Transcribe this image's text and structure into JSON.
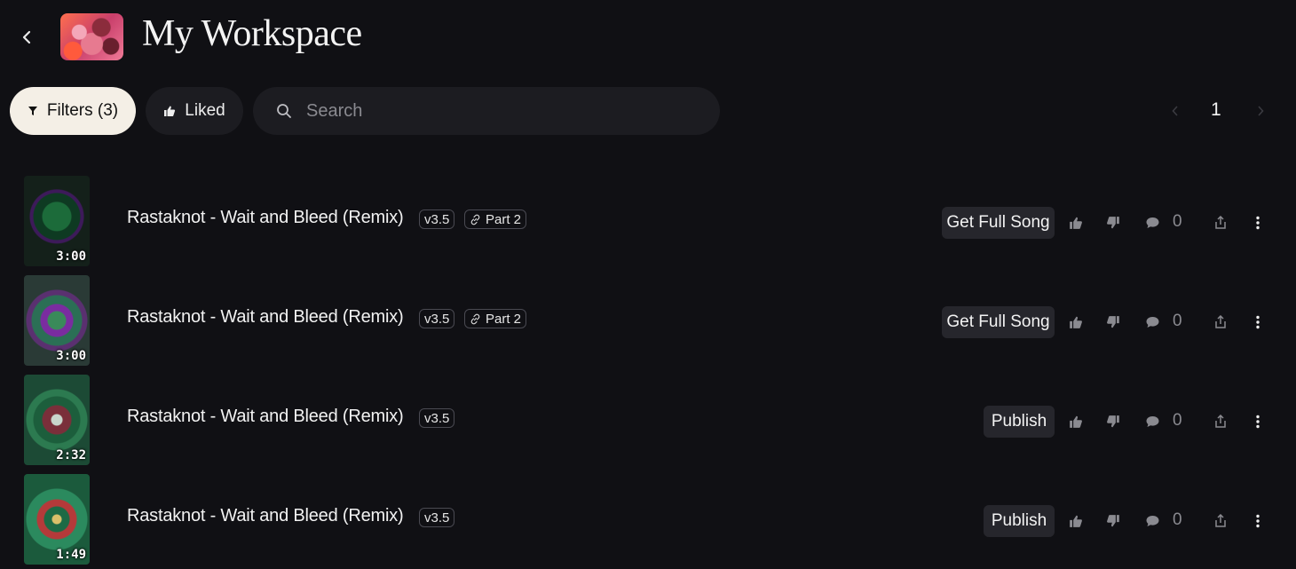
{
  "header": {
    "title": "My Workspace",
    "back_icon": "chevron-left-icon"
  },
  "toolbar": {
    "filters_label": "Filters (3)",
    "liked_label": "Liked",
    "search_placeholder": "Search",
    "search_value": ""
  },
  "pagination": {
    "current_page": "1"
  },
  "songs": [
    {
      "title": "Rastaknot - Wait and Bleed (Remix)",
      "duration": "3:00",
      "version": "v3.5",
      "part": "Part 2",
      "action": "Get Full Song",
      "comments": "0"
    },
    {
      "title": "Rastaknot - Wait and Bleed (Remix)",
      "duration": "3:00",
      "version": "v3.5",
      "part": "Part 2",
      "action": "Get Full Song",
      "comments": "0"
    },
    {
      "title": "Rastaknot - Wait and Bleed (Remix)",
      "duration": "2:32",
      "version": "v3.5",
      "part": "",
      "action": "Publish",
      "comments": "0"
    },
    {
      "title": "Rastaknot - Wait and Bleed (Remix)",
      "duration": "1:49",
      "version": "v3.5",
      "part": "",
      "action": "Publish",
      "comments": "0"
    }
  ],
  "colors": {
    "background": "#101014",
    "filters_pill": "#f4efe6",
    "pill_dark": "#1c1c21",
    "action_button": "#26262c",
    "muted_text": "#8a8a90"
  }
}
